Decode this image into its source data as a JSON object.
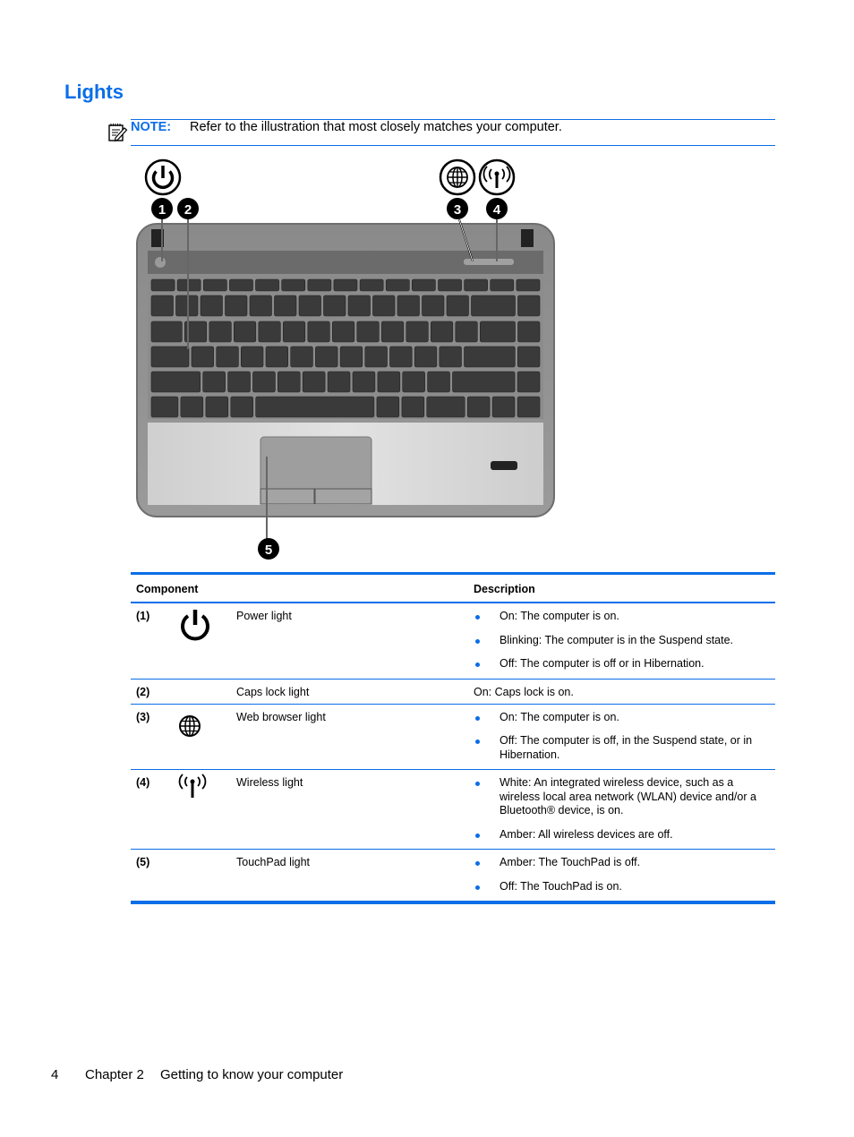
{
  "heading": "Lights",
  "note": {
    "icon": "note-pencil-icon",
    "label": "NOTE:",
    "text": "Refer to the illustration that most closely matches your computer."
  },
  "illustration": {
    "description": "Top view of laptop keyboard deck with numbered callouts",
    "callouts": [
      {
        "number": "1",
        "icon": "power-icon"
      },
      {
        "number": "2",
        "icon": null
      },
      {
        "number": "3",
        "icon": "globe-icon"
      },
      {
        "number": "4",
        "icon": "wireless-icon"
      },
      {
        "number": "5",
        "icon": null
      }
    ]
  },
  "table": {
    "headers": {
      "component": "Component",
      "description": "Description"
    },
    "rows": [
      {
        "num": "(1)",
        "icon": "power-icon",
        "name": "Power light",
        "bullets": [
          "On: The computer is on.",
          "Blinking: The computer is in the Suspend state.",
          "Off: The computer is off or in Hibernation."
        ]
      },
      {
        "num": "(2)",
        "icon": null,
        "name": "Caps lock light",
        "text": "On: Caps lock is on."
      },
      {
        "num": "(3)",
        "icon": "globe-icon",
        "name": "Web browser light",
        "bullets": [
          "On: The computer is on.",
          "Off: The computer is off, in the Suspend state, or in Hibernation."
        ]
      },
      {
        "num": "(4)",
        "icon": "wireless-icon",
        "name": "Wireless light",
        "bullets": [
          "White: An integrated wireless device, such as a wireless local area network (WLAN) device and/or a Bluetooth® device, is on.",
          "Amber: All wireless devices are off."
        ]
      },
      {
        "num": "(5)",
        "icon": null,
        "name": "TouchPad light",
        "bullets": [
          "Amber: The TouchPad is off.",
          "Off: The TouchPad is on."
        ]
      }
    ]
  },
  "footer": {
    "page_number": "4",
    "chapter": "Chapter 2",
    "chapter_title": "Getting to know your computer"
  },
  "colors": {
    "accent": "#0a6ee8"
  }
}
